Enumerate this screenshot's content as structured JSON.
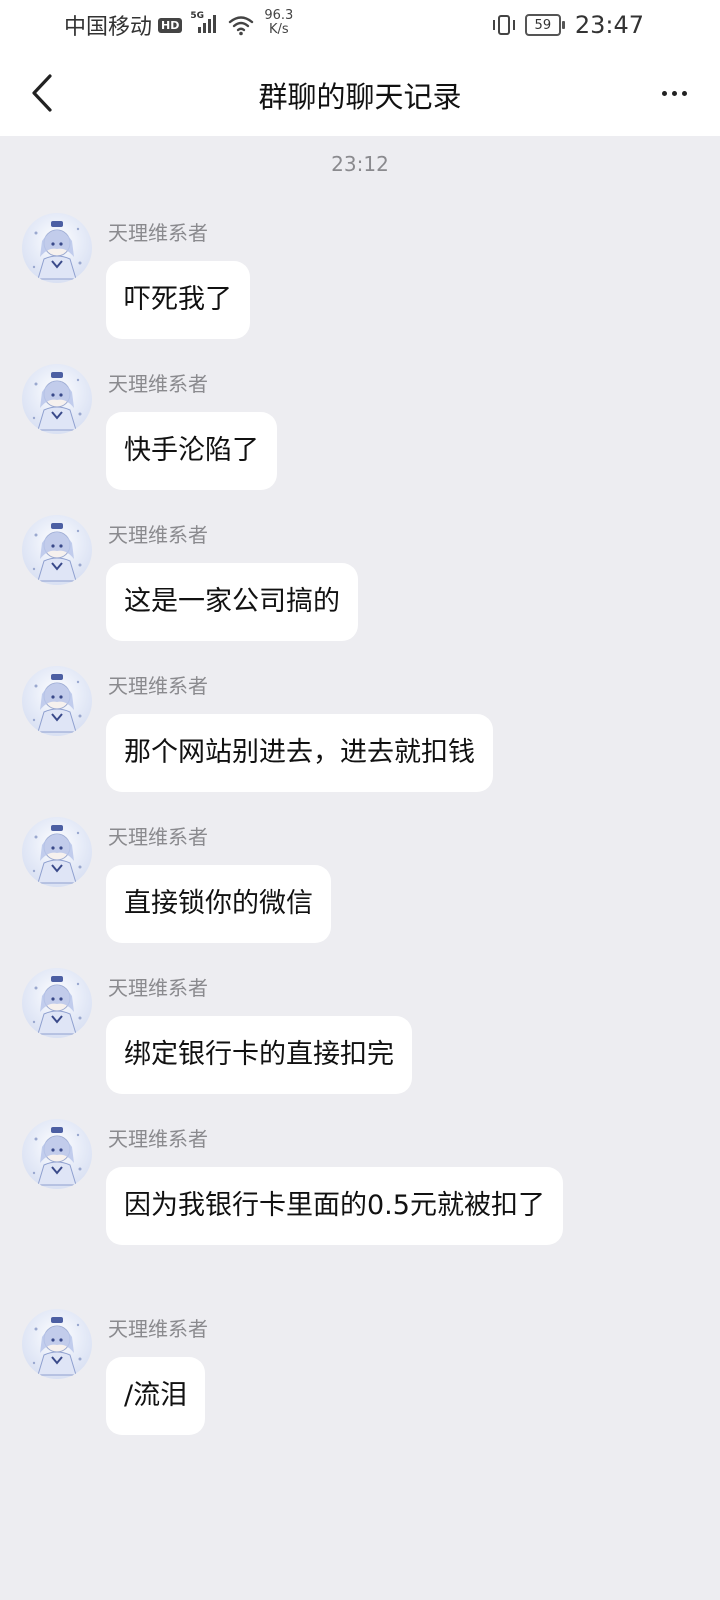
{
  "status_bar": {
    "carrier": "中国移动",
    "hd": "HD",
    "network": "5G",
    "speed_value": "96.3",
    "speed_unit": "K/s",
    "battery": "59",
    "time": "23:47"
  },
  "header": {
    "title": "群聊的聊天记录",
    "back_icon": "chevron-left-icon",
    "more_icon": "more-dots-icon"
  },
  "chat": {
    "timestamp": "23:12",
    "messages": [
      {
        "sender": "天理维系者",
        "text": "吓死我了"
      },
      {
        "sender": "天理维系者",
        "text": "快手沦陷了"
      },
      {
        "sender": "天理维系者",
        "text": "这是一家公司搞的"
      },
      {
        "sender": "天理维系者",
        "text": "那个网站别进去，进去就扣钱"
      },
      {
        "sender": "天理维系者",
        "text": "直接锁你的微信"
      },
      {
        "sender": "天理维系者",
        "text": "绑定银行卡的直接扣完"
      },
      {
        "sender": "天理维系者",
        "text": "因为我银行卡里面的0.5元就被扣了"
      },
      {
        "sender": "天理维系者",
        "text": "/流泪"
      }
    ]
  }
}
